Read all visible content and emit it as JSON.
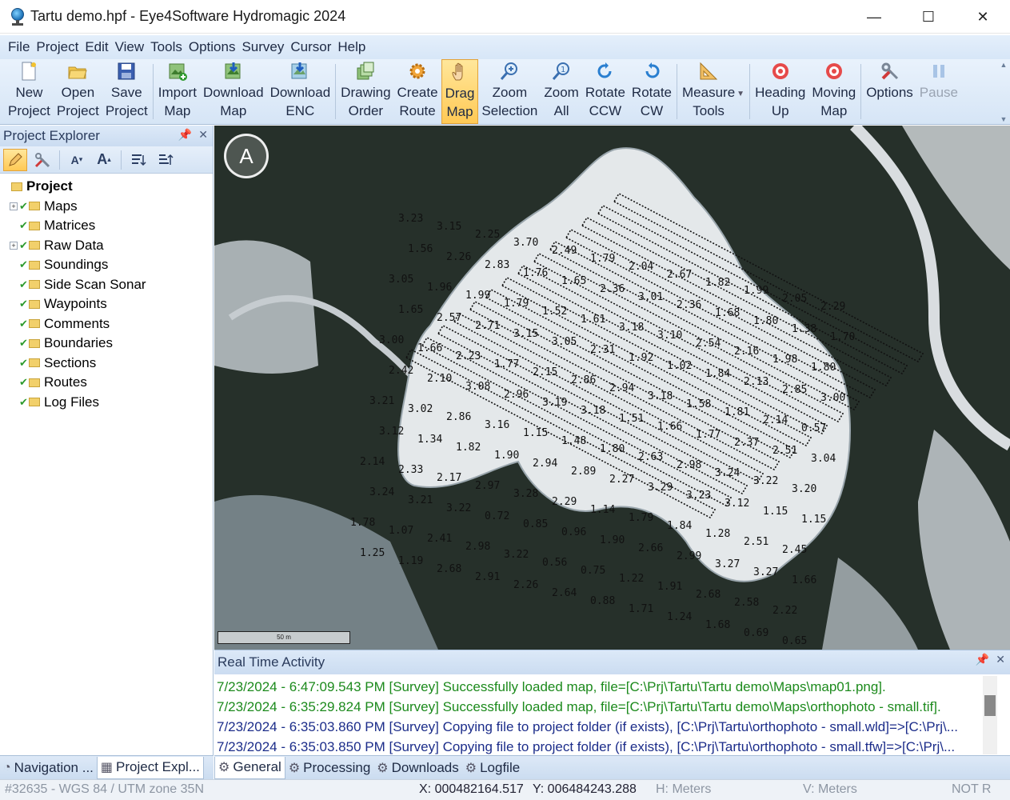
{
  "window": {
    "title": "Tartu demo.hpf - Eye4Software Hydromagic 2024",
    "minimize": "—",
    "maximize": "☐",
    "close": "✕"
  },
  "menu": [
    {
      "label": "File"
    },
    {
      "label": "Project"
    },
    {
      "label": "Edit"
    },
    {
      "label": "View"
    },
    {
      "label": "Tools"
    },
    {
      "label": "Options"
    },
    {
      "label": "Survey"
    },
    {
      "label": "Cursor"
    },
    {
      "label": "Help"
    }
  ],
  "toolbar": {
    "new_project": {
      "line1": "New",
      "line2": "Project",
      "icon": "new-file-icon"
    },
    "open_project": {
      "line1": "Open",
      "line2": "Project",
      "icon": "open-folder-icon"
    },
    "save_project": {
      "line1": "Save",
      "line2": "Project",
      "icon": "save-disk-icon"
    },
    "import_map": {
      "line1": "Import",
      "line2": "Map",
      "icon": "import-map-icon"
    },
    "download_map": {
      "line1": "Download",
      "line2": "Map",
      "icon": "download-map-icon"
    },
    "download_enc": {
      "line1": "Download",
      "line2": "ENC",
      "icon": "download-enc-icon"
    },
    "drawing_order": {
      "line1": "Drawing",
      "line2": "Order",
      "icon": "layers-icon"
    },
    "create_route": {
      "line1": "Create",
      "line2": "Route",
      "icon": "route-gear-icon"
    },
    "drag_map": {
      "line1": "Drag",
      "line2": "Map",
      "icon": "hand-icon"
    },
    "zoom_selection": {
      "line1": "Zoom",
      "line2": "Selection",
      "icon": "zoom-in-icon"
    },
    "zoom_all": {
      "line1": "Zoom",
      "line2": "All",
      "icon": "zoom-all-icon"
    },
    "rotate_ccw": {
      "line1": "Rotate",
      "line2": "CCW",
      "icon": "rotate-ccw-icon"
    },
    "rotate_cw": {
      "line1": "Rotate",
      "line2": "CW",
      "icon": "rotate-cw-icon"
    },
    "measure_tools": {
      "line1": "Measure",
      "line2": "Tools",
      "icon": "ruler-triangle-icon"
    },
    "heading_up": {
      "line1": "Heading",
      "line2": "Up",
      "icon": "target-icon"
    },
    "moving_map": {
      "line1": "Moving",
      "line2": "Map",
      "icon": "target-icon"
    },
    "options": {
      "line1": "Options",
      "line2": "",
      "icon": "tools-icon"
    },
    "pause": {
      "line1": "Pause",
      "line2": "",
      "icon": "pause-icon"
    }
  },
  "project_explorer": {
    "title": "Project Explorer",
    "root": "Project",
    "items": [
      {
        "label": "Maps",
        "expandable": true
      },
      {
        "label": "Matrices",
        "expandable": false
      },
      {
        "label": "Raw Data",
        "expandable": true
      },
      {
        "label": "Soundings",
        "expandable": false
      },
      {
        "label": "Side Scan Sonar",
        "expandable": false
      },
      {
        "label": "Waypoints",
        "expandable": false
      },
      {
        "label": "Comments",
        "expandable": false
      },
      {
        "label": "Boundaries",
        "expandable": false
      },
      {
        "label": "Sections",
        "expandable": false
      },
      {
        "label": "Routes",
        "expandable": false
      },
      {
        "label": "Log Files",
        "expandable": false
      }
    ]
  },
  "left_tabs": [
    {
      "label": "Navigation ...",
      "icon": "compass-icon"
    },
    {
      "label": "Project Expl...",
      "icon": "tree-icon"
    }
  ],
  "map": {
    "compass_glyph": "A",
    "scale_label": "50 m",
    "soundings": [
      "3.23",
      "3.15",
      "2.25",
      "3.70",
      "2.49",
      "1.79",
      "2.04",
      "2.67",
      "1.82",
      "1.99",
      "2.05",
      "2.29",
      "1.56",
      "2.26",
      "2.83",
      "1.76",
      "1.65",
      "2.36",
      "3.01",
      "2.36",
      "1.68",
      "1.80",
      "1.38",
      "1.70",
      "3.05",
      "1.96",
      "1.99",
      "1.79",
      "1.52",
      "1.61",
      "3.18",
      "3.10",
      "2.54",
      "2.16",
      "1.98",
      "1.80",
      "1.65",
      "2.57",
      "2.71",
      "3.15",
      "3.05",
      "2.31",
      "1.92",
      "1.02",
      "1.84",
      "2.13",
      "2.85",
      "3.00",
      "3.00",
      "1.66",
      "2.23",
      "1.77",
      "2.15",
      "2.86",
      "2.94",
      "3.18",
      "1.58",
      "1.81",
      "2.14",
      "0.57",
      "2.42",
      "2.10",
      "3.08",
      "2.96",
      "3.19",
      "3.18",
      "1.51",
      "1.66",
      "1.77",
      "2.37",
      "2.51",
      "3.04",
      "3.21",
      "3.02",
      "2.86",
      "3.16",
      "1.15",
      "1.48",
      "1.80",
      "2.63",
      "2.98",
      "3.24",
      "3.22",
      "3.20",
      "3.12",
      "1.34",
      "1.82",
      "1.90",
      "2.94",
      "2.89",
      "2.27",
      "3.29",
      "3.23",
      "3.12",
      "1.15",
      "1.15",
      "2.14",
      "2.33",
      "2.17",
      "2.97",
      "3.28",
      "2.29",
      "1.14",
      "1.79",
      "1.84",
      "1.28",
      "2.51",
      "2.45",
      "3.24",
      "3.21",
      "3.22",
      "0.72",
      "0.85",
      "0.96",
      "1.90",
      "2.66",
      "2.99",
      "3.27",
      "3.27",
      "1.66",
      "1.78",
      "1.07",
      "2.41",
      "2.98",
      "3.22",
      "0.56",
      "0.75",
      "1.22",
      "1.91",
      "2.68",
      "2.58",
      "2.22",
      "1.25",
      "1.19",
      "2.68",
      "2.91",
      "2.26",
      "2.64",
      "0.88",
      "1.71",
      "1.24",
      "1.68",
      "0.69",
      "0.65"
    ]
  },
  "activity": {
    "title": "Real Time Activity",
    "lines": [
      {
        "text": "7/23/2024 - 6:47:09.543 PM [Survey] Successfully loaded map, file=[C:\\Prj\\Tartu\\Tartu demo\\Maps\\map01.png].",
        "color": "green"
      },
      {
        "text": "7/23/2024 - 6:35:29.824 PM [Survey] Successfully loaded map, file=[C:\\Prj\\Tartu\\Tartu demo\\Maps\\orthophoto - small.tif].",
        "color": "green"
      },
      {
        "text": "7/23/2024 - 6:35:03.860 PM [Survey] Copying file to project folder (if exists), [C:\\Prj\\Tartu\\orthophoto - small.wld]=>[C:\\Prj\\...",
        "color": "blue"
      },
      {
        "text": "7/23/2024 - 6:35:03.850 PM [Survey] Copying file to project folder (if exists), [C:\\Prj\\Tartu\\orthophoto - small.tfw]=>[C:\\Prj\\...",
        "color": "blue"
      }
    ]
  },
  "bottom_tabs": [
    {
      "label": "General",
      "icon": "gear-icon"
    },
    {
      "label": "Processing",
      "icon": "gear-icon"
    },
    {
      "label": "Downloads",
      "icon": "gear-icon"
    },
    {
      "label": "Logfile",
      "icon": "gear-icon"
    }
  ],
  "status": {
    "projection": "#32635 - WGS 84 / UTM zone 35N",
    "x": "X: 000482164.517",
    "y": "Y: 006484243.288",
    "h_units": "H: Meters",
    "v_units": "V: Meters",
    "not_label": "NOT R"
  },
  "colors": {
    "accent": "#ffc955",
    "log_green": "#1c8a1c",
    "log_blue": "#1c2d8a"
  }
}
